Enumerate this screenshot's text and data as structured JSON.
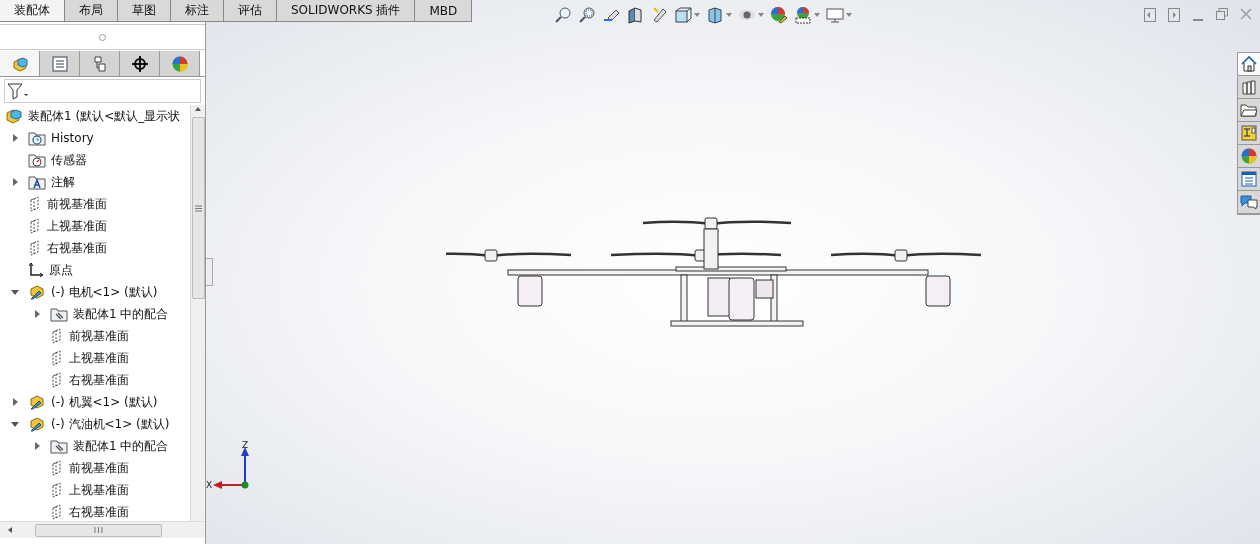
{
  "tabs": [
    {
      "label": "装配体",
      "selected": true
    },
    {
      "label": "布局",
      "selected": false
    },
    {
      "label": "草图",
      "selected": false
    },
    {
      "label": "标注",
      "selected": false
    },
    {
      "label": "评估",
      "selected": false
    },
    {
      "label": "SOLIDWORKS 插件",
      "selected": false
    },
    {
      "label": "MBD",
      "selected": false
    }
  ],
  "panel_tabs": [
    {
      "kind": "feature",
      "selected": true
    },
    {
      "kind": "property",
      "selected": false
    },
    {
      "kind": "config",
      "selected": false
    },
    {
      "kind": "target",
      "selected": false
    },
    {
      "kind": "display",
      "selected": false
    }
  ],
  "tree": {
    "label": "装配体1  (默认<默认_显示状",
    "kind": "assembly",
    "children": [
      {
        "label": "History",
        "kind": "history",
        "expanded": false
      },
      {
        "label": "传感器",
        "kind": "sensor"
      },
      {
        "label": "注解",
        "kind": "annotation",
        "expanded": false
      },
      {
        "label": "前视基准面",
        "kind": "plane"
      },
      {
        "label": "上视基准面",
        "kind": "plane"
      },
      {
        "label": "右视基准面",
        "kind": "plane"
      },
      {
        "label": "原点",
        "kind": "origin"
      },
      {
        "label": "(-) 电机<1> (默认)",
        "kind": "part",
        "expanded": true,
        "children": [
          {
            "label": "装配体1 中的配合",
            "kind": "mates",
            "expanded": false
          },
          {
            "label": "前视基准面",
            "kind": "plane"
          },
          {
            "label": "上视基准面",
            "kind": "plane"
          },
          {
            "label": "右视基准面",
            "kind": "plane"
          }
        ]
      },
      {
        "label": "(-) 机翼<1> (默认)",
        "kind": "part",
        "expanded": false
      },
      {
        "label": "(-) 汽油机<1> (默认)",
        "kind": "part",
        "expanded": true,
        "children": [
          {
            "label": "装配体1 中的配合",
            "kind": "mates",
            "expanded": false
          },
          {
            "label": "前视基准面",
            "kind": "plane"
          },
          {
            "label": "上视基准面",
            "kind": "plane"
          },
          {
            "label": "右视基准面",
            "kind": "plane"
          }
        ]
      }
    ]
  },
  "task_pane": [
    {
      "kind": "home",
      "selected": true
    },
    {
      "kind": "library",
      "selected": false
    },
    {
      "kind": "folder",
      "selected": false
    },
    {
      "kind": "palette",
      "selected": false
    },
    {
      "kind": "appearance",
      "selected": false
    },
    {
      "kind": "properties",
      "selected": false
    },
    {
      "kind": "forum",
      "selected": false
    }
  ],
  "triad": {
    "x_label": "X",
    "z_label": "Z"
  }
}
